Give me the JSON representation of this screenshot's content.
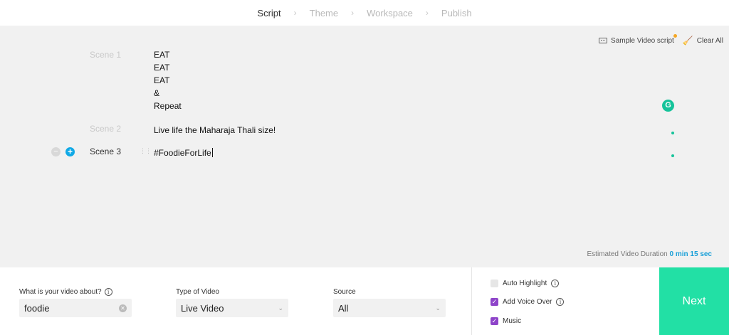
{
  "stepper": {
    "steps": [
      "Script",
      "Theme",
      "Workspace",
      "Publish"
    ],
    "separator": "›"
  },
  "toolbar": {
    "sample_script_label": "Sample Video script",
    "clear_all_label": "Clear All"
  },
  "scenes": [
    {
      "label": "Scene 1",
      "lines": [
        "EAT",
        "EAT",
        "EAT",
        "&",
        "Repeat"
      ]
    },
    {
      "label": "Scene 2",
      "lines": [
        "Live life the Maharaja Thali size!"
      ]
    },
    {
      "label": "Scene 3",
      "lines": [
        "#FoodieForLife"
      ]
    }
  ],
  "scene_controls": {
    "remove": "−",
    "add": "+"
  },
  "grammarly_badge": "G",
  "duration": {
    "label": "Estimated Video Duration",
    "value": "0 min 15 sec"
  },
  "form": {
    "about_label": "What is your video about?",
    "about_value": "foodie",
    "type_label": "Type of Video",
    "type_value": "Live Video",
    "source_label": "Source",
    "source_value": "All"
  },
  "options": {
    "auto_highlight": {
      "label": "Auto Highlight",
      "checked": false
    },
    "voice_over": {
      "label": "Add Voice Over",
      "checked": true
    },
    "music": {
      "label": "Music",
      "checked": true
    }
  },
  "next_label": "Next",
  "colors": {
    "accent_green": "#22e0a5",
    "checkbox_purple": "#8e44c9",
    "link_blue": "#1aa0d8"
  }
}
